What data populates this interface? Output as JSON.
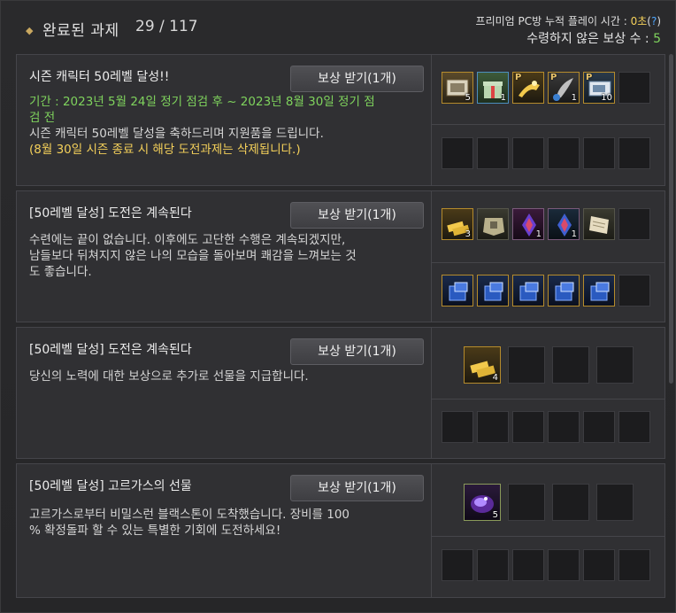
{
  "header": {
    "title": "완료된 과제",
    "count": "29 / 117",
    "pcroom_label": "프리미엄 PC방 누적 플레이 시간 : ",
    "pcroom_time": "0초",
    "pcroom_help": "?",
    "unclaimed_label": "수령하지 않은 보상 수 : ",
    "unclaimed_count": "5"
  },
  "claim_label": "보상 받기(1개)",
  "cards": [
    {
      "name": "시즌 캐릭터 50레벨 달성!!",
      "period_line1": "기간 : 2023년 5월 24일 정기 점검 후 ~ 2023년 8월 30일 정기 점",
      "period_line2": "검 전",
      "desc_line1": "시즌 캐릭터 50레벨 달성을 축하드리며 지원품을 드립니다.",
      "desc_line2": "(8월 30일 시즌 종료 시 해당 도전과제는 삭제됩니다.)",
      "items": [
        {
          "icon": "ticket-icon",
          "qty": "5",
          "p": ""
        },
        {
          "icon": "gift-box-icon",
          "qty": "1",
          "p": ""
        },
        {
          "icon": "gold-horn-icon",
          "qty": "",
          "p": "P"
        },
        {
          "icon": "feather-icon",
          "qty": "1",
          "p": "P"
        },
        {
          "icon": "coupon-icon",
          "qty": "10",
          "p": "P"
        }
      ]
    },
    {
      "name": "[50레벨 달성] 도전은 계속된다",
      "desc_line1": "수련에는 끝이 없습니다. 이후에도 고단한 수행은 계속되겠지만,",
      "desc_line2": "남들보다 뒤쳐지지 않은 나의 모습을 돌아보며 쾌감을 느껴보는 것",
      "desc_line3": "도 좋습니다.",
      "items_row1": [
        {
          "icon": "gold-bar-icon",
          "qty": "3"
        },
        {
          "icon": "armor-chest-icon",
          "qty": ""
        },
        {
          "icon": "red-crystal-icon",
          "qty": "1"
        },
        {
          "icon": "blue-crystal-icon",
          "qty": "1"
        },
        {
          "icon": "scroll-icon",
          "qty": ""
        }
      ],
      "items_row2": [
        {
          "icon": "blue-crate-icon",
          "qty": ""
        },
        {
          "icon": "blue-crate-icon",
          "qty": ""
        },
        {
          "icon": "blue-crate-icon",
          "qty": ""
        },
        {
          "icon": "blue-crate-icon",
          "qty": ""
        },
        {
          "icon": "blue-crate-icon",
          "qty": ""
        }
      ]
    },
    {
      "name": "[50레벨 달성] 도전은 계속된다",
      "desc_line1": "당신의 노력에 대한 보상으로 추가로 선물을 지급합니다.",
      "items": [
        {
          "icon": "gold-bar-icon",
          "qty": "4"
        }
      ]
    },
    {
      "name": "[50레벨 달성] 고르가스의 선물",
      "desc_line1": "고르가스로부터 비밀스런 블랙스톤이 도착했습니다. 장비를 100",
      "desc_line2": "% 확정돌파 할 수 있는 특별한 기회에 도전하세요!",
      "items": [
        {
          "icon": "purple-blackstone-icon",
          "qty": "5"
        }
      ]
    }
  ]
}
